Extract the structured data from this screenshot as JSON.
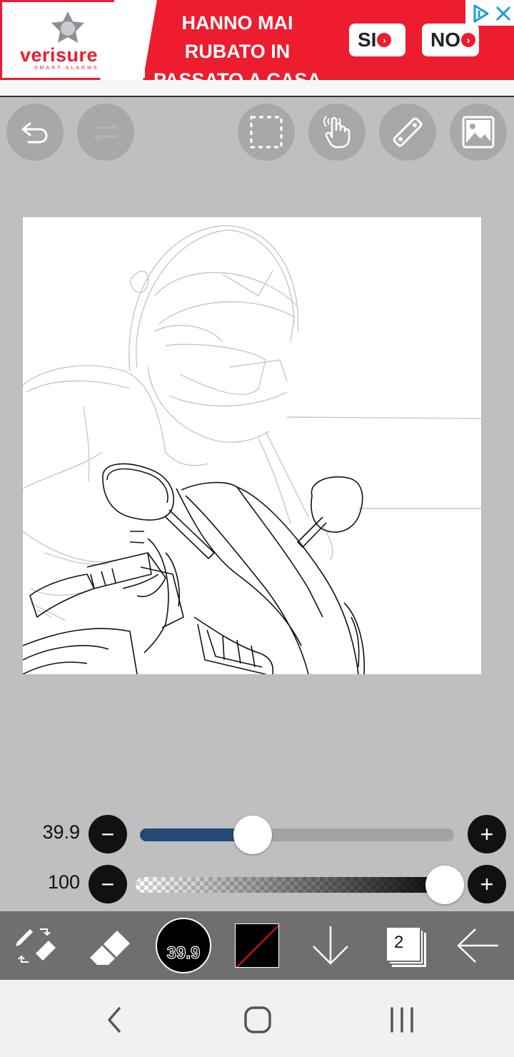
{
  "ad": {
    "brand": "verisure",
    "brand_sub": "SMART ALARMS",
    "headline_line1": "HANNO MAI",
    "headline_line2": "RUBATO IN",
    "headline_line3": "PASSATO A CASA",
    "yes_label": "SI",
    "no_label": "NO",
    "brand_color": "#ed1c2e"
  },
  "toolbar": {
    "icons": [
      "undo-icon",
      "redo-icon",
      "selection-icon",
      "hand-gesture-icon",
      "ruler-icon",
      "image-icon"
    ]
  },
  "brush": {
    "size_value": "39.9",
    "size_fraction": 0.35,
    "opacity_value": "100",
    "opacity_fraction": 1.0,
    "accent": "#234a75"
  },
  "bottom_bar": {
    "brush_size_label": "39.9",
    "layer_count": "2",
    "icons": [
      "brush-eraser-swap-icon",
      "eraser-icon",
      "brush-size-icon",
      "color-swatch-icon",
      "move-down-icon",
      "layers-icon",
      "back-arrow-icon"
    ]
  },
  "nav": {
    "icons": [
      "back-icon",
      "home-icon",
      "recents-icon"
    ]
  }
}
